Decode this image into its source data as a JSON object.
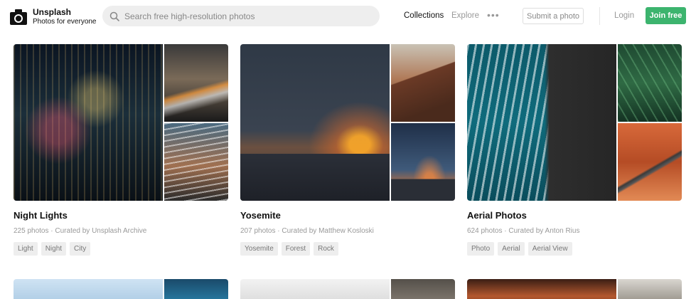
{
  "header": {
    "brand_name": "Unsplash",
    "brand_tagline": "Photos for everyone",
    "search_placeholder": "Search free high-resolution photos",
    "nav": {
      "collections": "Collections",
      "explore": "Explore",
      "more": "•••"
    },
    "submit_label": "Submit a photo",
    "login_label": "Login",
    "join_label": "Join free",
    "join_color": "#3cb46e"
  },
  "collections": [
    {
      "title": "Night Lights",
      "photo_count": "225 photos",
      "curator": "Curated by Unsplash Archive",
      "tags": [
        "Light",
        "Night",
        "City"
      ]
    },
    {
      "title": "Yosemite",
      "photo_count": "207 photos",
      "curator": "Curated by Matthew Kosloski",
      "tags": [
        "Yosemite",
        "Forest",
        "Rock"
      ]
    },
    {
      "title": "Aerial Photos",
      "photo_count": "624 photos",
      "curator": "Curated by Anton Rius",
      "tags": [
        "Photo",
        "Aerial",
        "Aerial View"
      ]
    }
  ]
}
